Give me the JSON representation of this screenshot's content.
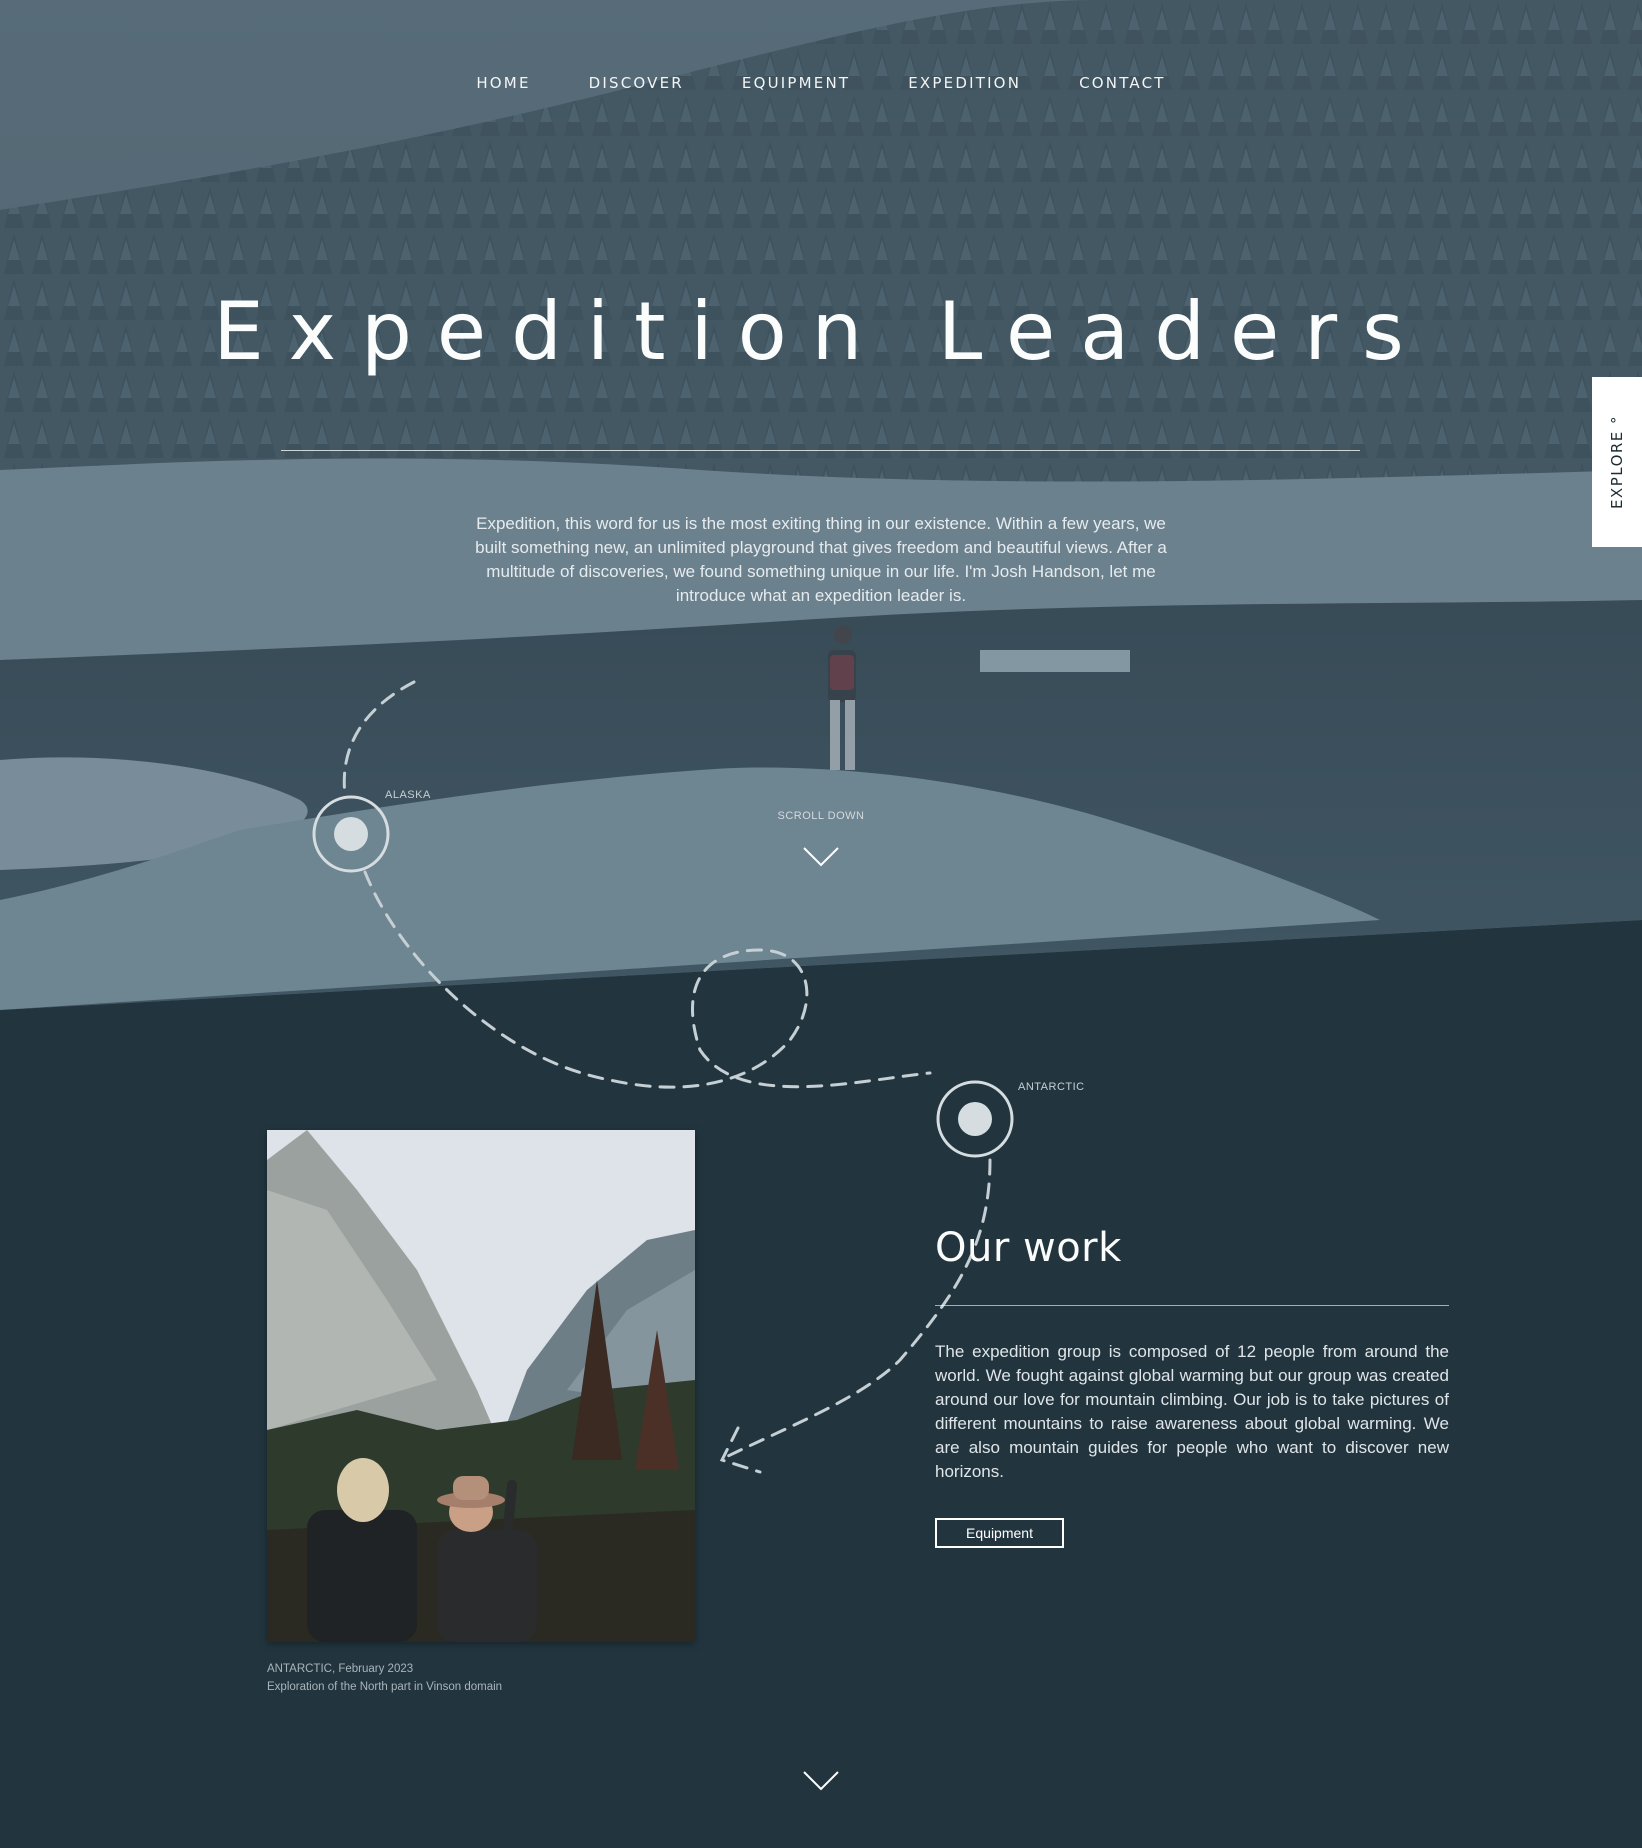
{
  "nav": {
    "items": [
      "HOME",
      "DISCOVER",
      "EQUIPMENT",
      "EXPEDITION",
      "CONTACT"
    ]
  },
  "hero": {
    "title": "Expedition Leaders",
    "intro": "Expedition, this word for us is the most exiting thing in our existence. Within a few years, we built something new, an unlimited playground that gives freedom and beautiful views. After a multitude of discoveries, we found something unique in our life. I'm Josh Handson, let me introduce what an expedition leader is.",
    "scroll_label": "SCROLL DOWN",
    "image_subject": "snowy pine forest around a lake with a hiker standing on a rock"
  },
  "explore_tab": {
    "label": "EXPLORE °"
  },
  "locations": {
    "alaska": "ALASKA",
    "antarctic": "ANTARCTIC"
  },
  "work": {
    "title": "Our work",
    "body": "The expedition group is composed of 12 people from around the world. We fought against global warming but our group was created around our love for mountain climbing. Our job is to take pictures of different mountains to raise awareness about global warming. We are also mountain guides for people who want to discover new horizons.",
    "button_label": "Equipment",
    "photo_subject": "two hikers in a forested mountain valley",
    "caption_line1": "ANTARCTIC, February 2023",
    "caption_line2": "Exploration of the North part in Vinson domain"
  },
  "icons": {
    "scroll": "chevron-down-icon",
    "next_section": "chevron-down-icon"
  },
  "colors": {
    "background": "#22353f",
    "hero_overlay": "#4f6876",
    "text": "#ffffff"
  }
}
